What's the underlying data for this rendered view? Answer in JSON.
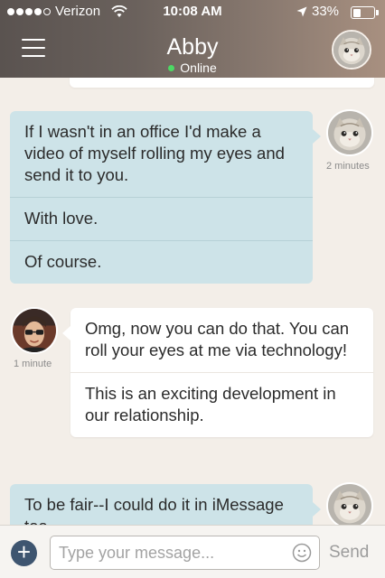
{
  "status_bar": {
    "carrier": "Verizon",
    "time": "10:08 AM",
    "battery": "33%",
    "signal_bars_filled": 4,
    "signal_bars_total": 5
  },
  "nav": {
    "title": "Abby",
    "status": "Online",
    "online_color": "#4cd964",
    "menu_icon": "hamburger-icon",
    "contact_avatar": "kitten-avatar"
  },
  "messages": [
    {
      "direction": "outgoing",
      "avatar": "kitten-avatar",
      "timestamp": "2 minutes",
      "parts": [
        "If I wasn't in an office I'd make a video of myself rolling my eyes and send it to you.",
        "With love.",
        "Of course."
      ]
    },
    {
      "direction": "incoming",
      "avatar": "user-avatar",
      "timestamp": "1 minute",
      "parts": [
        "Omg, now you can do that. You can roll your eyes at me via technology!",
        "This is an exciting development in our relationship."
      ]
    },
    {
      "direction": "outgoing",
      "avatar": "kitten-avatar",
      "timestamp": "",
      "parts": [
        "To be fair--I could do it in iMessage too."
      ]
    }
  ],
  "composer": {
    "placeholder": "Type your message...",
    "send_label": "Send",
    "add_icon": "plus-icon",
    "emoji_icon": "smiley-icon"
  },
  "colors": {
    "outgoing_bubble": "#cde3e8",
    "incoming_bubble": "#ffffff",
    "background": "#f3eee8",
    "add_button": "#3e5570"
  }
}
